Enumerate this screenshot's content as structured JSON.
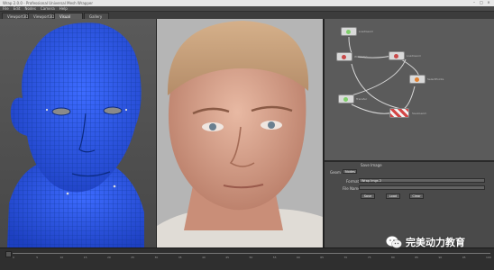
{
  "window": {
    "title": "Wrap 2.0.0 - Professional Universal Mesh Wrapper",
    "controls": [
      "–",
      "□",
      "×"
    ]
  },
  "menu": [
    "File",
    "Edit",
    "Nodes",
    "Camera",
    "Help"
  ],
  "tabs": [
    {
      "label": "Viewport3D",
      "active": false
    },
    {
      "label": "Viewport3D",
      "active": false
    },
    {
      "label": "Visual Editor",
      "active": true
    },
    {
      "label": "Gallery",
      "active": false
    }
  ],
  "node_graph": {
    "nodes": [
      {
        "label": "LoadGeom",
        "color": "#7fcf6b"
      },
      {
        "label": "Wrapping",
        "color": "#c94a4a"
      },
      {
        "label": "LoadGeom",
        "color": "#c94a4a"
      },
      {
        "label": "Transfer",
        "color": "#7fcf6b"
      },
      {
        "label": "SelectPoints",
        "color": "#e08030"
      },
      {
        "label": "SaveGeom",
        "color": "#d24545"
      }
    ]
  },
  "properties": {
    "header": "Save Image",
    "fields": [
      {
        "label": "Geom",
        "value": "Nodes"
      },
      {
        "label": "Format",
        "value": "Wrap Imgs 2"
      },
      {
        "label": "File Name",
        "value": ""
      }
    ],
    "buttons": [
      "Save",
      "Load",
      "Clear"
    ]
  },
  "timeline": {
    "ticks": [
      "0",
      "5",
      "10",
      "15",
      "20",
      "25",
      "30",
      "35",
      "40",
      "45",
      "50",
      "55",
      "60",
      "65",
      "70",
      "75",
      "80",
      "85",
      "90",
      "95",
      "100"
    ]
  },
  "watermark": {
    "text": "完美动力教育"
  },
  "colors": {
    "mesh_blue": "#2a55e8",
    "wire": "#123a9e",
    "skin": "#d9a08a",
    "graph_bg": "#5b5b5b"
  }
}
